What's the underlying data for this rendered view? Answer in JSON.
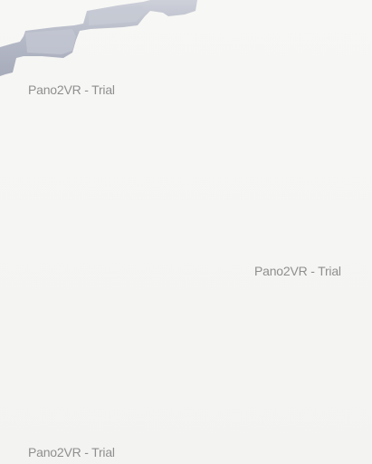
{
  "app": {
    "name": "Pano2VR"
  },
  "viewer": {
    "watermarks": [
      "Pano2VR - Trial",
      "Pano2VR - Trial",
      "Pano2VR - Trial"
    ]
  },
  "colors": {
    "background": "#f5f5f3",
    "watermark_text": "#8f8f8f",
    "pano_edge": "#aeb3c2"
  }
}
